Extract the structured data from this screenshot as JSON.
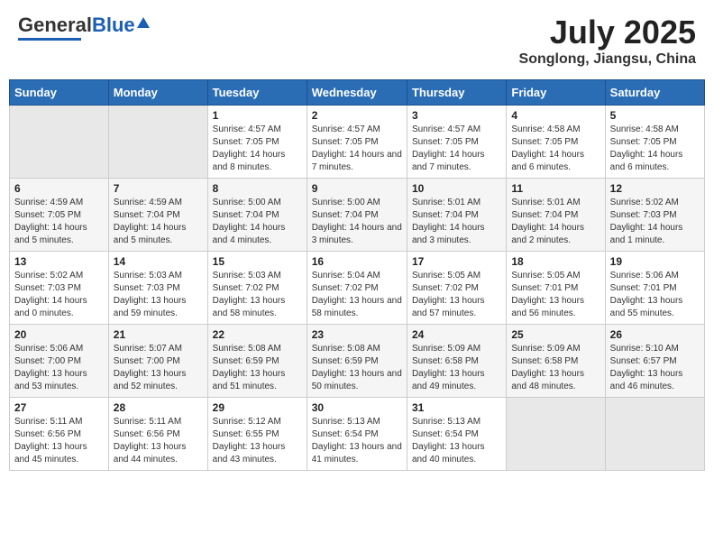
{
  "header": {
    "logo_general": "General",
    "logo_blue": "Blue",
    "month_year": "July 2025",
    "location": "Songlong, Jiangsu, China"
  },
  "days_of_week": [
    "Sunday",
    "Monday",
    "Tuesday",
    "Wednesday",
    "Thursday",
    "Friday",
    "Saturday"
  ],
  "weeks": [
    [
      {
        "day": "",
        "info": ""
      },
      {
        "day": "",
        "info": ""
      },
      {
        "day": "1",
        "info": "Sunrise: 4:57 AM\nSunset: 7:05 PM\nDaylight: 14 hours and 8 minutes."
      },
      {
        "day": "2",
        "info": "Sunrise: 4:57 AM\nSunset: 7:05 PM\nDaylight: 14 hours and 7 minutes."
      },
      {
        "day": "3",
        "info": "Sunrise: 4:57 AM\nSunset: 7:05 PM\nDaylight: 14 hours and 7 minutes."
      },
      {
        "day": "4",
        "info": "Sunrise: 4:58 AM\nSunset: 7:05 PM\nDaylight: 14 hours and 6 minutes."
      },
      {
        "day": "5",
        "info": "Sunrise: 4:58 AM\nSunset: 7:05 PM\nDaylight: 14 hours and 6 minutes."
      }
    ],
    [
      {
        "day": "6",
        "info": "Sunrise: 4:59 AM\nSunset: 7:05 PM\nDaylight: 14 hours and 5 minutes."
      },
      {
        "day": "7",
        "info": "Sunrise: 4:59 AM\nSunset: 7:04 PM\nDaylight: 14 hours and 5 minutes."
      },
      {
        "day": "8",
        "info": "Sunrise: 5:00 AM\nSunset: 7:04 PM\nDaylight: 14 hours and 4 minutes."
      },
      {
        "day": "9",
        "info": "Sunrise: 5:00 AM\nSunset: 7:04 PM\nDaylight: 14 hours and 3 minutes."
      },
      {
        "day": "10",
        "info": "Sunrise: 5:01 AM\nSunset: 7:04 PM\nDaylight: 14 hours and 3 minutes."
      },
      {
        "day": "11",
        "info": "Sunrise: 5:01 AM\nSunset: 7:04 PM\nDaylight: 14 hours and 2 minutes."
      },
      {
        "day": "12",
        "info": "Sunrise: 5:02 AM\nSunset: 7:03 PM\nDaylight: 14 hours and 1 minute."
      }
    ],
    [
      {
        "day": "13",
        "info": "Sunrise: 5:02 AM\nSunset: 7:03 PM\nDaylight: 14 hours and 0 minutes."
      },
      {
        "day": "14",
        "info": "Sunrise: 5:03 AM\nSunset: 7:03 PM\nDaylight: 13 hours and 59 minutes."
      },
      {
        "day": "15",
        "info": "Sunrise: 5:03 AM\nSunset: 7:02 PM\nDaylight: 13 hours and 58 minutes."
      },
      {
        "day": "16",
        "info": "Sunrise: 5:04 AM\nSunset: 7:02 PM\nDaylight: 13 hours and 58 minutes."
      },
      {
        "day": "17",
        "info": "Sunrise: 5:05 AM\nSunset: 7:02 PM\nDaylight: 13 hours and 57 minutes."
      },
      {
        "day": "18",
        "info": "Sunrise: 5:05 AM\nSunset: 7:01 PM\nDaylight: 13 hours and 56 minutes."
      },
      {
        "day": "19",
        "info": "Sunrise: 5:06 AM\nSunset: 7:01 PM\nDaylight: 13 hours and 55 minutes."
      }
    ],
    [
      {
        "day": "20",
        "info": "Sunrise: 5:06 AM\nSunset: 7:00 PM\nDaylight: 13 hours and 53 minutes."
      },
      {
        "day": "21",
        "info": "Sunrise: 5:07 AM\nSunset: 7:00 PM\nDaylight: 13 hours and 52 minutes."
      },
      {
        "day": "22",
        "info": "Sunrise: 5:08 AM\nSunset: 6:59 PM\nDaylight: 13 hours and 51 minutes."
      },
      {
        "day": "23",
        "info": "Sunrise: 5:08 AM\nSunset: 6:59 PM\nDaylight: 13 hours and 50 minutes."
      },
      {
        "day": "24",
        "info": "Sunrise: 5:09 AM\nSunset: 6:58 PM\nDaylight: 13 hours and 49 minutes."
      },
      {
        "day": "25",
        "info": "Sunrise: 5:09 AM\nSunset: 6:58 PM\nDaylight: 13 hours and 48 minutes."
      },
      {
        "day": "26",
        "info": "Sunrise: 5:10 AM\nSunset: 6:57 PM\nDaylight: 13 hours and 46 minutes."
      }
    ],
    [
      {
        "day": "27",
        "info": "Sunrise: 5:11 AM\nSunset: 6:56 PM\nDaylight: 13 hours and 45 minutes."
      },
      {
        "day": "28",
        "info": "Sunrise: 5:11 AM\nSunset: 6:56 PM\nDaylight: 13 hours and 44 minutes."
      },
      {
        "day": "29",
        "info": "Sunrise: 5:12 AM\nSunset: 6:55 PM\nDaylight: 13 hours and 43 minutes."
      },
      {
        "day": "30",
        "info": "Sunrise: 5:13 AM\nSunset: 6:54 PM\nDaylight: 13 hours and 41 minutes."
      },
      {
        "day": "31",
        "info": "Sunrise: 5:13 AM\nSunset: 6:54 PM\nDaylight: 13 hours and 40 minutes."
      },
      {
        "day": "",
        "info": ""
      },
      {
        "day": "",
        "info": ""
      }
    ]
  ]
}
